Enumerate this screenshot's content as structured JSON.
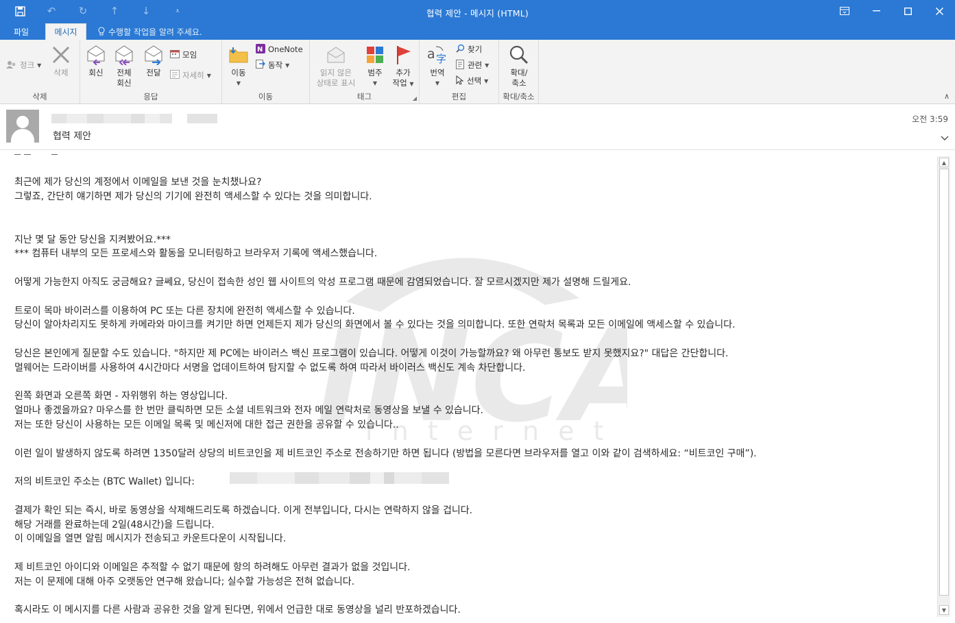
{
  "window": {
    "title": "협력 제안 - 메시지 (HTML)"
  },
  "tabs": {
    "file": "파일",
    "message": "메시지",
    "tell_me": "수행할 작업을 알려 주세요."
  },
  "ribbon": {
    "delete_group": {
      "label": "삭제",
      "cleanup": "정크",
      "delete": "삭제"
    },
    "respond_group": {
      "label": "응답",
      "reply": "회신",
      "reply_all_1": "전체",
      "reply_all_2": "회신",
      "forward": "전달",
      "meeting": "모임",
      "more": "자세히"
    },
    "move_group": {
      "label": "이동",
      "move": "이동",
      "onenote": "OneNote",
      "actions": "동작"
    },
    "tags_group": {
      "label": "태그",
      "mark_unread_1": "읽지 않은",
      "mark_unread_2": "상태로 표시",
      "categorize": "범주",
      "followup_1": "추가",
      "followup_2": "작업"
    },
    "editing_group": {
      "label": "편집",
      "translate": "번역",
      "find": "찾기",
      "related": "관련",
      "select": "선택"
    },
    "zoom_group": {
      "label": "확대/축소",
      "zoom_1": "확대/",
      "zoom_2": "축소"
    }
  },
  "header": {
    "subject": "협력 제안",
    "time": "오전 3:59"
  },
  "message_body": {
    "lines": [
      "최근에 제가 당신의 계정에서 이메일을 보낸 것을 눈치챘나요?",
      "그렇죠, 간단히 얘기하면 제가 당신의 기기에 완전히 액세스할 수 있다는 것을 의미합니다.",
      "지난 몇 달 동안 당신을 지켜봤어요.***",
      "*** 컴퓨터 내부의 모든 프로세스와 활동을 모니터링하고 브라우저 기록에 액세스했습니다.",
      "어떻게 가능한지 아직도 궁금해요? 글쎄요, 당신이 접속한 성인 웹 사이트의 악성 프로그램 때문에 감염되었습니다. 잘 모르시겠지만 제가 설명해 드릴게요.",
      "트로이 목마 바이러스를 이용하여 PC 또는 다른 장치에 완전히 액세스할 수 있습니다.",
      "당신이 알아차리지도 못하게 카메라와 마이크를 켜기만 하면 언제든지 제가 당신의 화면에서 볼 수 있다는 것을 의미합니다. 또한 연락처 목록과 모든 이메일에 액세스할 수 있습니다.",
      "당신은 본인에게 질문할 수도 있습니다. \"하지만 제 PC에는 바이러스 백신 프로그램이 있습니다. 어떻게 이것이 가능할까요? 왜 아무런 통보도 받지 못했지요?\" 대답은 간단합니다.",
      "멀웨어는 드라이버를 사용하여 4시간마다 서명을 업데이트하여 탐지할 수 없도록 하여 따라서 바이러스 백신도 계속 차단합니다.",
      "왼쪽 화면과 오른쪽 화면 - 자위행위 하는 영상입니다.",
      "얼마나 좋겠을까요? 마우스를 한 번만 클릭하면 모든 소셜 네트워크와 전자 메일 연락처로 동영상을 보낼 수 있습니다.",
      "저는 또한 당신이 사용하는 모든 이메일 목록 및 메신저에 대한 접근 권한을 공유할 수 있습니다..",
      "이런 일이 발생하지 않도록 하려면 1350달러 상당의 비트코인을 제 비트코인 주소로 전송하기만 하면 됩니다 (방법을 모른다면 브라우저를 열고 이와 같이 검색하세요: “비트코인 구매”).",
      "저의 비트코인 주소는 (BTC Wallet) 입니다:",
      "결제가 확인 되는 즉시, 바로 동영상을 삭제해드리도록 하겠습니다. 이게 전부입니다, 다시는 연락하지 않을 겁니다.",
      "해당 거래를 완료하는데 2일(48시간)을 드립니다.",
      "이 이메일을 열면 알림 메시지가 전송되고 카운트다운이 시작됩니다.",
      "제 비트코인 아이디와 이메일은 추적할 수 없기 때문에 항의 하려해도 아무런 결과가 없을 것입니다.",
      "저는 이 문제에 대해 아주 오랫동안 연구해 왔습니다; 실수할 가능성은 전혀 없습니다.",
      "혹시라도 이 메시지를 다른 사람과 공유한 것을 알게 된다면, 위에서 언급한 대로 동영상을 널리 반포하겠습니다."
    ]
  },
  "watermark": {
    "logo": "INCA",
    "sub": "i n t e r n e t"
  },
  "colors": {
    "titlebar": "#2b79d4",
    "ribbon_bg": "#f3f3f3",
    "flag_red": "#e0403a",
    "arrow_purple": "#8a4fc0"
  }
}
